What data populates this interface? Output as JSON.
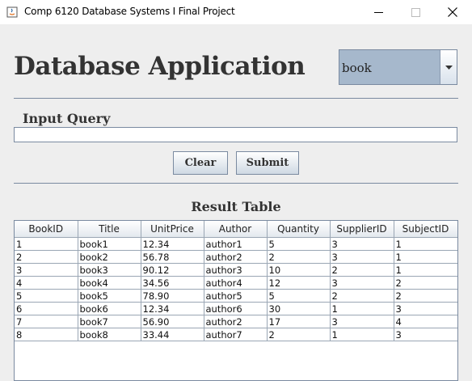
{
  "window": {
    "title": "Comp 6120 Database Systems I Final Project"
  },
  "header": {
    "title": "Database Application",
    "table_select": {
      "selected": "book"
    }
  },
  "query": {
    "label": "Input Query",
    "value": ""
  },
  "buttons": {
    "clear": "Clear",
    "submit": "Submit"
  },
  "result": {
    "title": "Result Table",
    "columns": [
      "BookID",
      "Title",
      "UnitPrice",
      "Author",
      "Quantity",
      "SupplierID",
      "SubjectID"
    ],
    "rows": [
      [
        "1",
        "book1",
        "12.34",
        "author1",
        "5",
        "3",
        "1"
      ],
      [
        "2",
        "book2",
        "56.78",
        "author2",
        "2",
        "3",
        "1"
      ],
      [
        "3",
        "book3",
        "90.12",
        "author3",
        "10",
        "2",
        "1"
      ],
      [
        "4",
        "book4",
        "34.56",
        "author4",
        "12",
        "3",
        "2"
      ],
      [
        "5",
        "book5",
        "78.90",
        "author5",
        "5",
        "2",
        "2"
      ],
      [
        "6",
        "book6",
        "12.34",
        "author6",
        "30",
        "1",
        "3"
      ],
      [
        "7",
        "book7",
        "56.90",
        "author2",
        "17",
        "3",
        "4"
      ],
      [
        "8",
        "book8",
        "33.44",
        "author7",
        "2",
        "1",
        "3"
      ]
    ]
  }
}
